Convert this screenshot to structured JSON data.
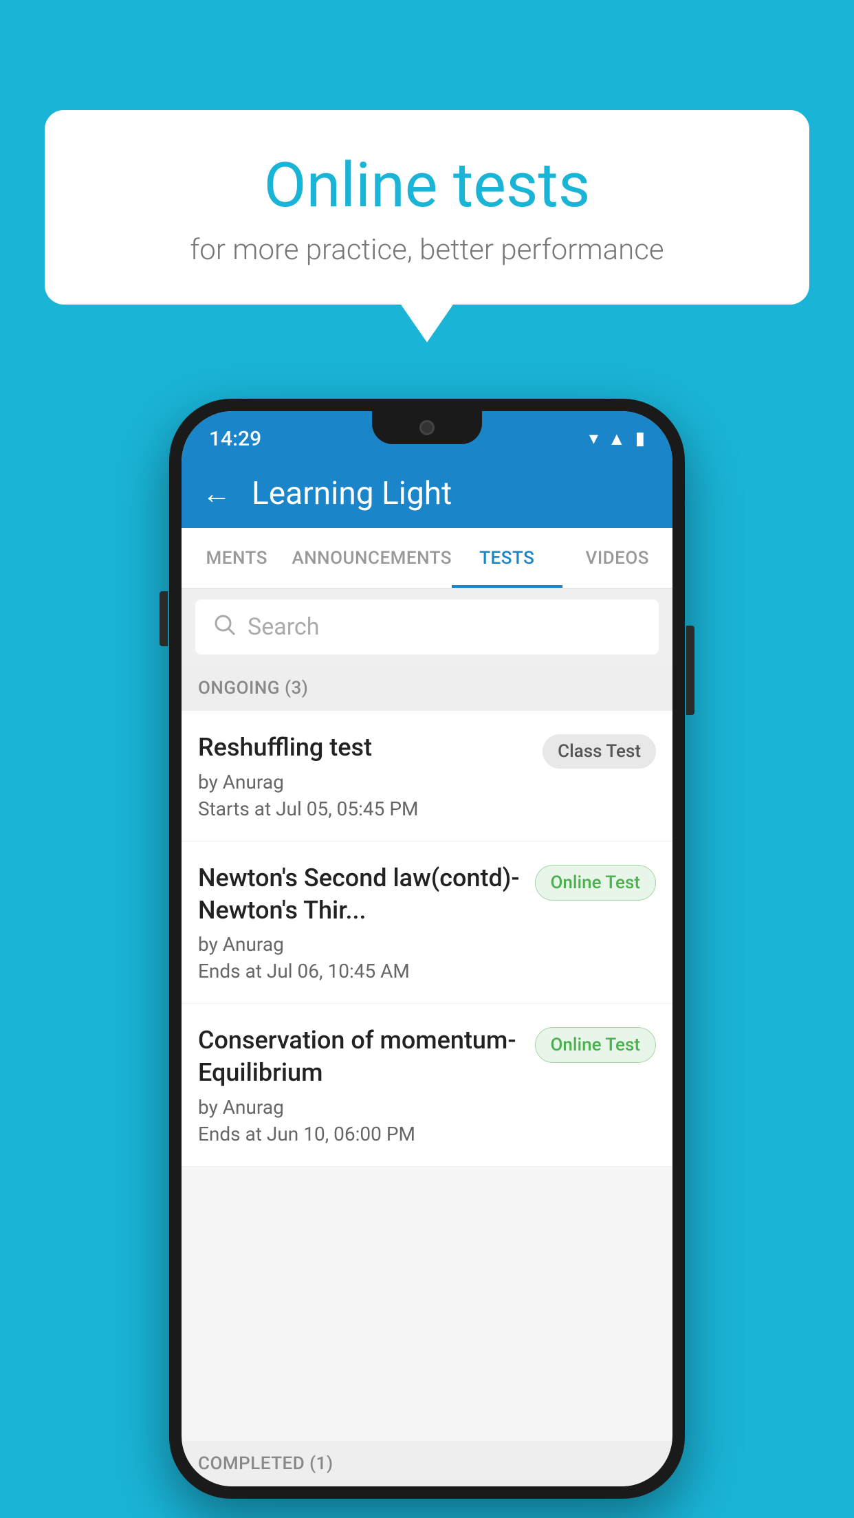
{
  "background_color": "#1ab4d7",
  "speech_bubble": {
    "title": "Online tests",
    "subtitle": "for more practice, better performance"
  },
  "phone": {
    "status_bar": {
      "time": "14:29",
      "icons": [
        "wifi",
        "signal",
        "battery"
      ]
    },
    "app_bar": {
      "title": "Learning Light",
      "back_label": "←"
    },
    "tabs": [
      {
        "label": "MENTS",
        "active": false
      },
      {
        "label": "ANNOUNCEMENTS",
        "active": false
      },
      {
        "label": "TESTS",
        "active": true
      },
      {
        "label": "VIDEOS",
        "active": false
      }
    ],
    "search": {
      "placeholder": "Search"
    },
    "ongoing_section": {
      "header": "ONGOING (3)",
      "items": [
        {
          "name": "Reshuffling test",
          "author": "by Anurag",
          "date_label": "Starts at",
          "date": "Jul 05, 05:45 PM",
          "badge": "Class Test",
          "badge_type": "class"
        },
        {
          "name": "Newton's Second law(contd)-Newton's Thir...",
          "author": "by Anurag",
          "date_label": "Ends at",
          "date": "Jul 06, 10:45 AM",
          "badge": "Online Test",
          "badge_type": "online"
        },
        {
          "name": "Conservation of momentum-Equilibrium",
          "author": "by Anurag",
          "date_label": "Ends at",
          "date": "Jun 10, 06:00 PM",
          "badge": "Online Test",
          "badge_type": "online"
        }
      ]
    },
    "completed_section": {
      "header": "COMPLETED (1)"
    }
  }
}
